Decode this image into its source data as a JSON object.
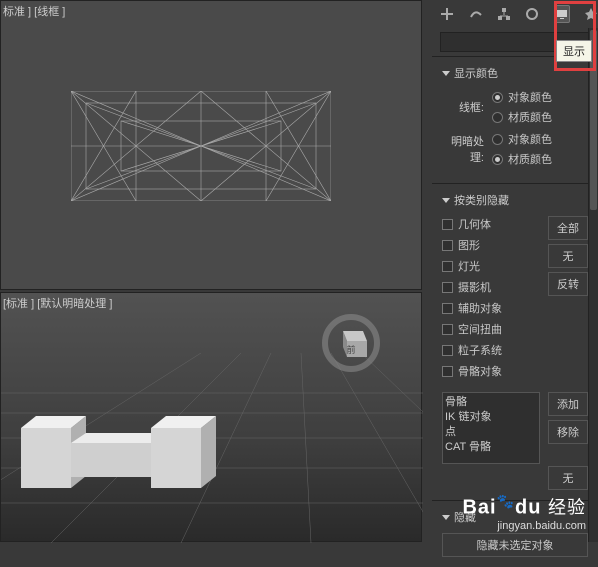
{
  "viewport": {
    "top_label": "标准 ] [线框 ]",
    "bottom_label": "[标准 ]  [默认明暗处理 ]",
    "gizmo_label": "前"
  },
  "tooltip": "显示",
  "sections": {
    "display_color": {
      "title": "显示颜色",
      "wireframe_label": "线框:",
      "shading_label": "明暗处理:",
      "options": {
        "object_color": "对象颜色",
        "material_color": "材质颜色"
      }
    },
    "hide_by_category": {
      "title": "按类别隐藏",
      "items": {
        "geometry": "几何体",
        "shapes": "图形",
        "lights": "灯光",
        "cameras": "摄影机",
        "helpers": "辅助对象",
        "space_warps": "空间扭曲",
        "particle_systems": "粒子系统",
        "bone_objects": "骨骼对象"
      },
      "buttons": {
        "all": "全部",
        "none": "无",
        "invert": "反转"
      },
      "list": {
        "l1": "骨骼",
        "l2": "IK 链对象",
        "l3": "点",
        "l4": "CAT 骨骼"
      },
      "list_buttons": {
        "add": "添加",
        "remove": "移除",
        "none2": "无"
      }
    },
    "hide": {
      "title": "隐藏",
      "sub": "隐藏未选定对象"
    }
  },
  "watermark": {
    "brand_a": "Bai",
    "brand_b": "du",
    "brand_suffix": "经验",
    "url": "jingyan.baidu.com"
  }
}
